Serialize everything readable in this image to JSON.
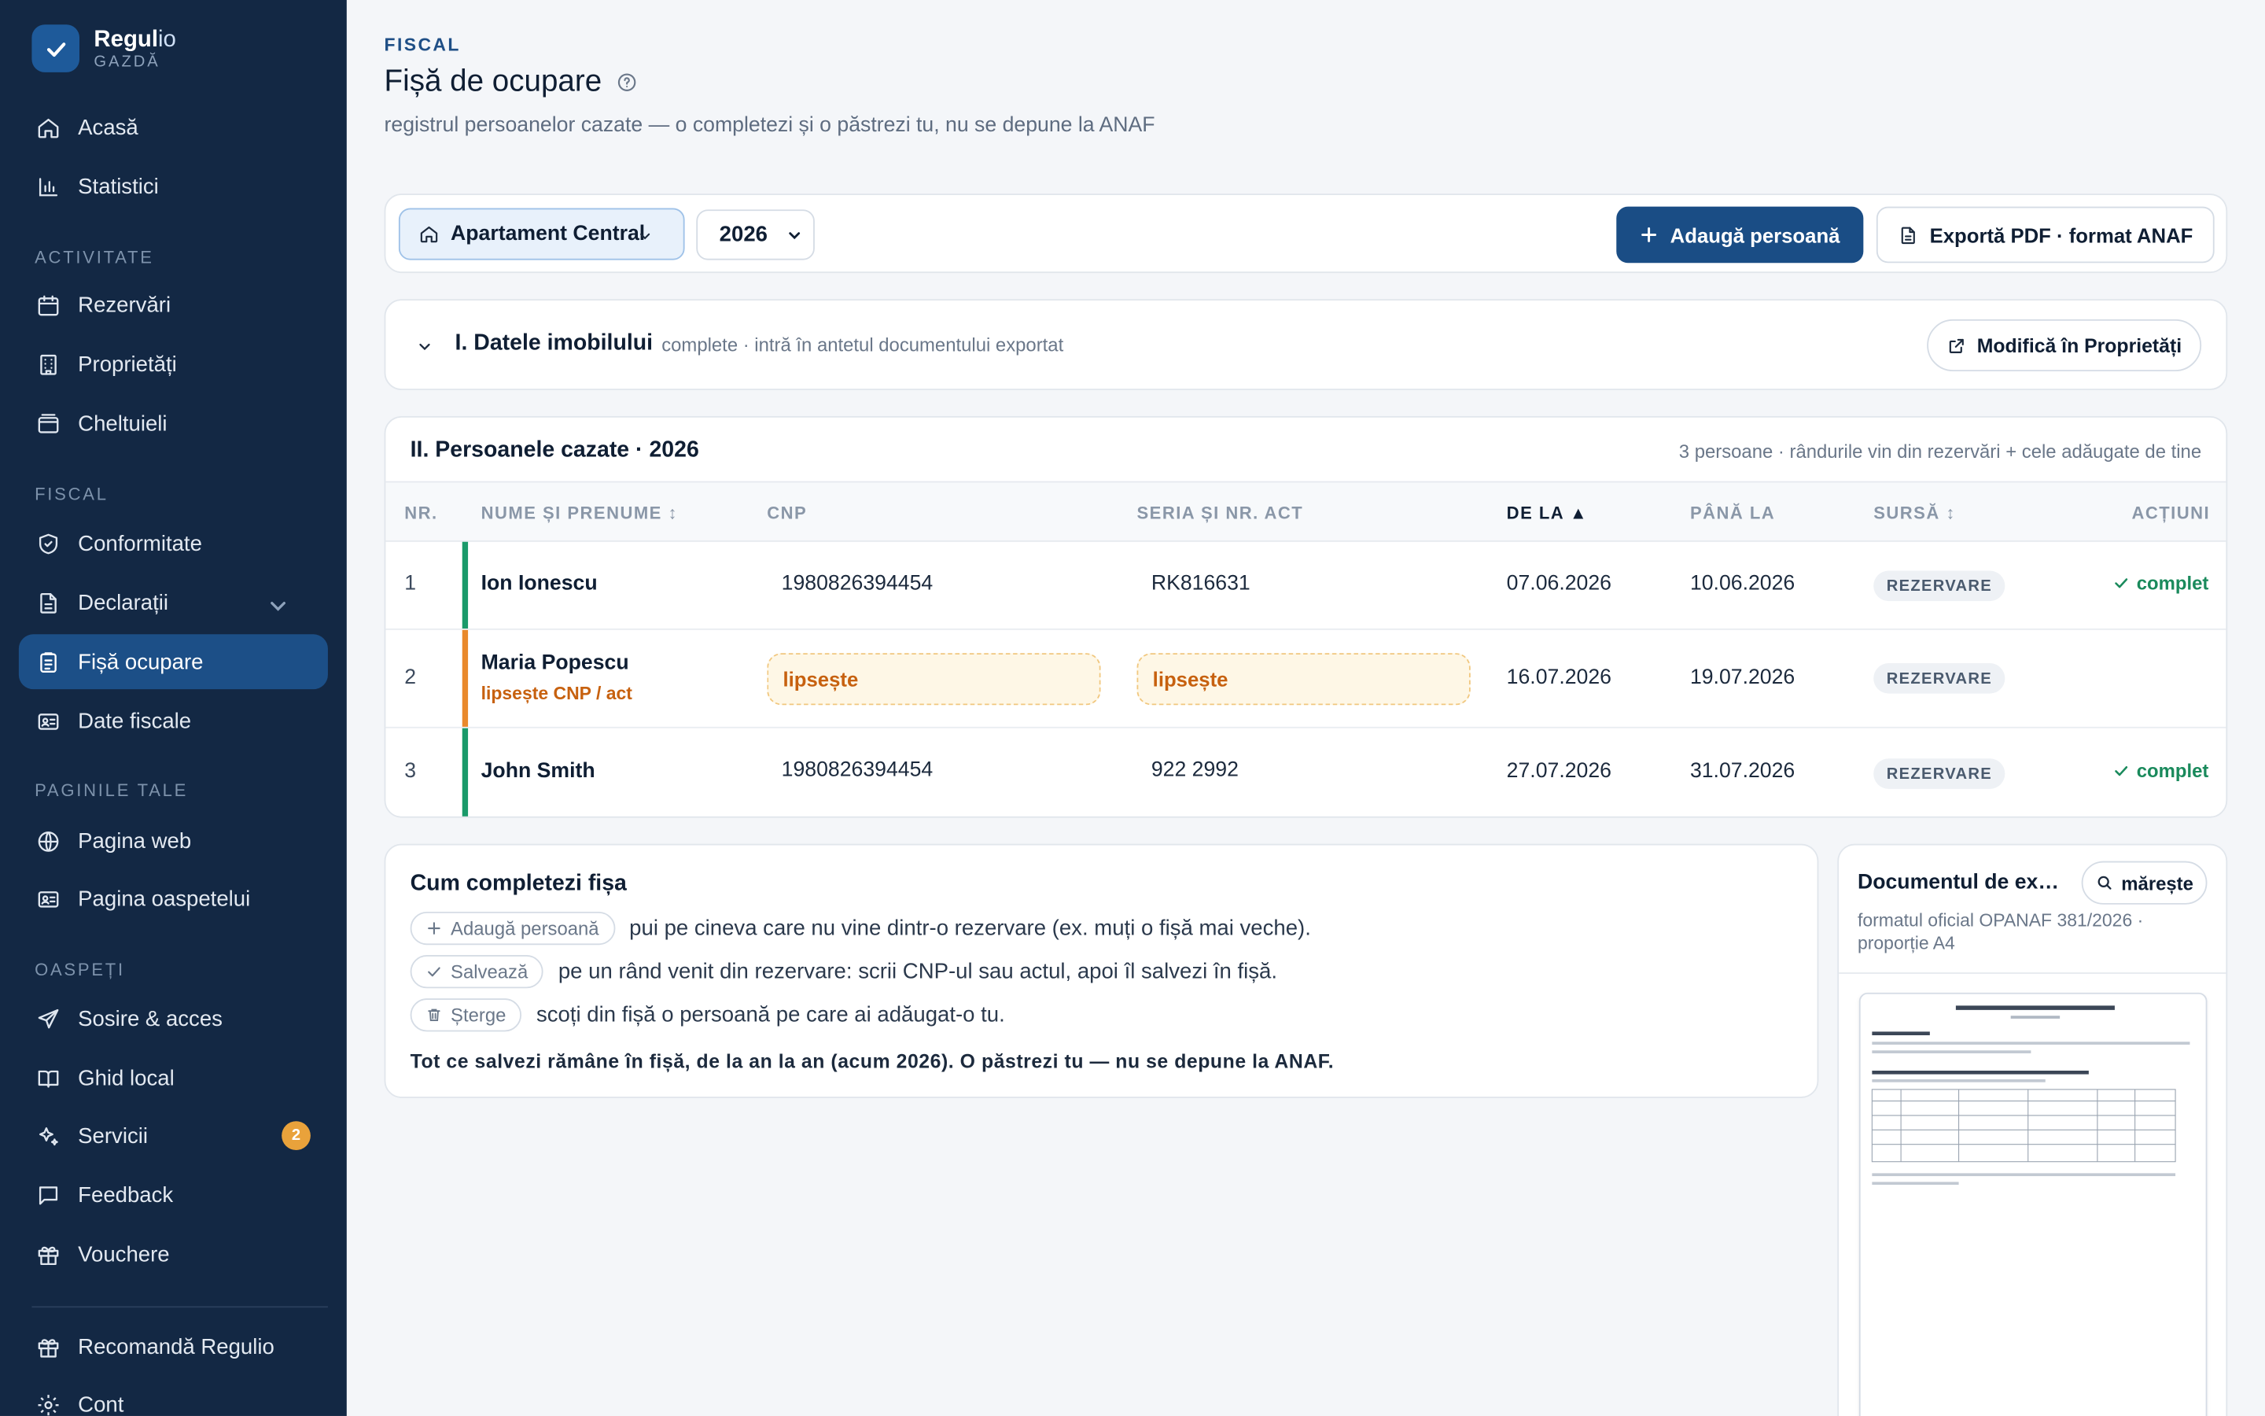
{
  "brand": {
    "name_main": "Regul",
    "name_accent": "io",
    "sub": "GAZDĂ"
  },
  "nav": {
    "home": "Acasă",
    "stats": "Statistici",
    "section_activity": "ACTIVITATE",
    "bookings": "Rezervări",
    "properties": "Proprietăți",
    "expenses": "Cheltuieli",
    "section_fiscal": "FISCAL",
    "compliance": "Conformitate",
    "declarations": "Declarații",
    "occupancy": "Fișă ocupare",
    "fiscal_data": "Date fiscale",
    "section_pages": "PAGINILE TALE",
    "web_page": "Pagina web",
    "guest_page": "Pagina oaspetelui",
    "section_guests": "OASPEȚI",
    "arrival": "Sosire & acces",
    "local_guide": "Ghid local",
    "services": "Servicii",
    "services_badge": "2",
    "feedback": "Feedback",
    "vouchers": "Vouchere",
    "refer": "Recomandă Regulio",
    "account": "Cont"
  },
  "header": {
    "kicker": "FISCAL",
    "title": "Fișă de ocupare",
    "subtitle": "registrul persoanelor cazate — o completezi și o păstrezi tu, nu se depune la ANAF"
  },
  "toolbar": {
    "property": "Apartament Central",
    "year": "2026",
    "add_person": "Adaugă persoană",
    "export": "Exportă PDF · format ANAF"
  },
  "section1": {
    "title": "I. Datele imobilului",
    "note": "complete · intră în antetul documentului exportat",
    "edit_button": "Modifică în Proprietăți"
  },
  "section2": {
    "title": "II. Persoanele cazate · 2026",
    "note": "3 persoane · rândurile vin din rezervări + cele adăugate de tine",
    "columns": {
      "nr": "NR.",
      "name": "NUME ȘI PRENUME",
      "cnp": "CNP",
      "id_doc": "SERIA ȘI NR. ACT",
      "from": "DE LA",
      "to": "PÂNĂ LA",
      "source": "SURSĂ",
      "actions": "ACȚIUNI"
    },
    "rows": [
      {
        "nr": "1",
        "name": "Ion Ionescu",
        "cnp": "1980826394454",
        "id_doc": "RK816631",
        "from": "07.06.2026",
        "to": "10.06.2026",
        "source": "REZERVARE",
        "status": "complet"
      },
      {
        "nr": "2",
        "name": "Maria Popescu",
        "warning": "lipsește CNP / act",
        "cnp": "lipsește",
        "id_doc": "lipsește",
        "from": "16.07.2026",
        "to": "19.07.2026",
        "source": "REZERVARE"
      },
      {
        "nr": "3",
        "name": "John Smith",
        "cnp": "1980826394454",
        "id_doc": "922 2992",
        "from": "27.07.2026",
        "to": "31.07.2026",
        "source": "REZERVARE",
        "status": "complet"
      }
    ]
  },
  "howto": {
    "title": "Cum completezi fișa",
    "items": [
      {
        "chip": "Adaugă persoană",
        "text": "pui pe cineva care nu vine dintr-o rezervare (ex. muți o fișă mai veche)."
      },
      {
        "chip": "Salvează",
        "text": "pe un rând venit din rezervare: scrii CNP-ul sau actul, apoi îl salvezi în fișă."
      },
      {
        "chip": "Șterge",
        "text": "scoți din fișă o persoană pe care ai adăugat-o tu."
      }
    ],
    "note": "Tot ce salvezi rămâne în fișă, de la an la an (acum 2026). O păstrezi tu — nu se depune la ANAF."
  },
  "preview": {
    "title": "Documentul de export",
    "zoom": "mărește",
    "note": "formatul oficial OPANAF 381/2026 · proporție A4"
  },
  "colors": {
    "sidebar": "#132844",
    "primary": "#1a4d85",
    "ok": "#1a8a5c",
    "warn": "#c7610f",
    "row_ok_bar": "#1a9a6a",
    "row_warn_bar": "#e9892b"
  }
}
